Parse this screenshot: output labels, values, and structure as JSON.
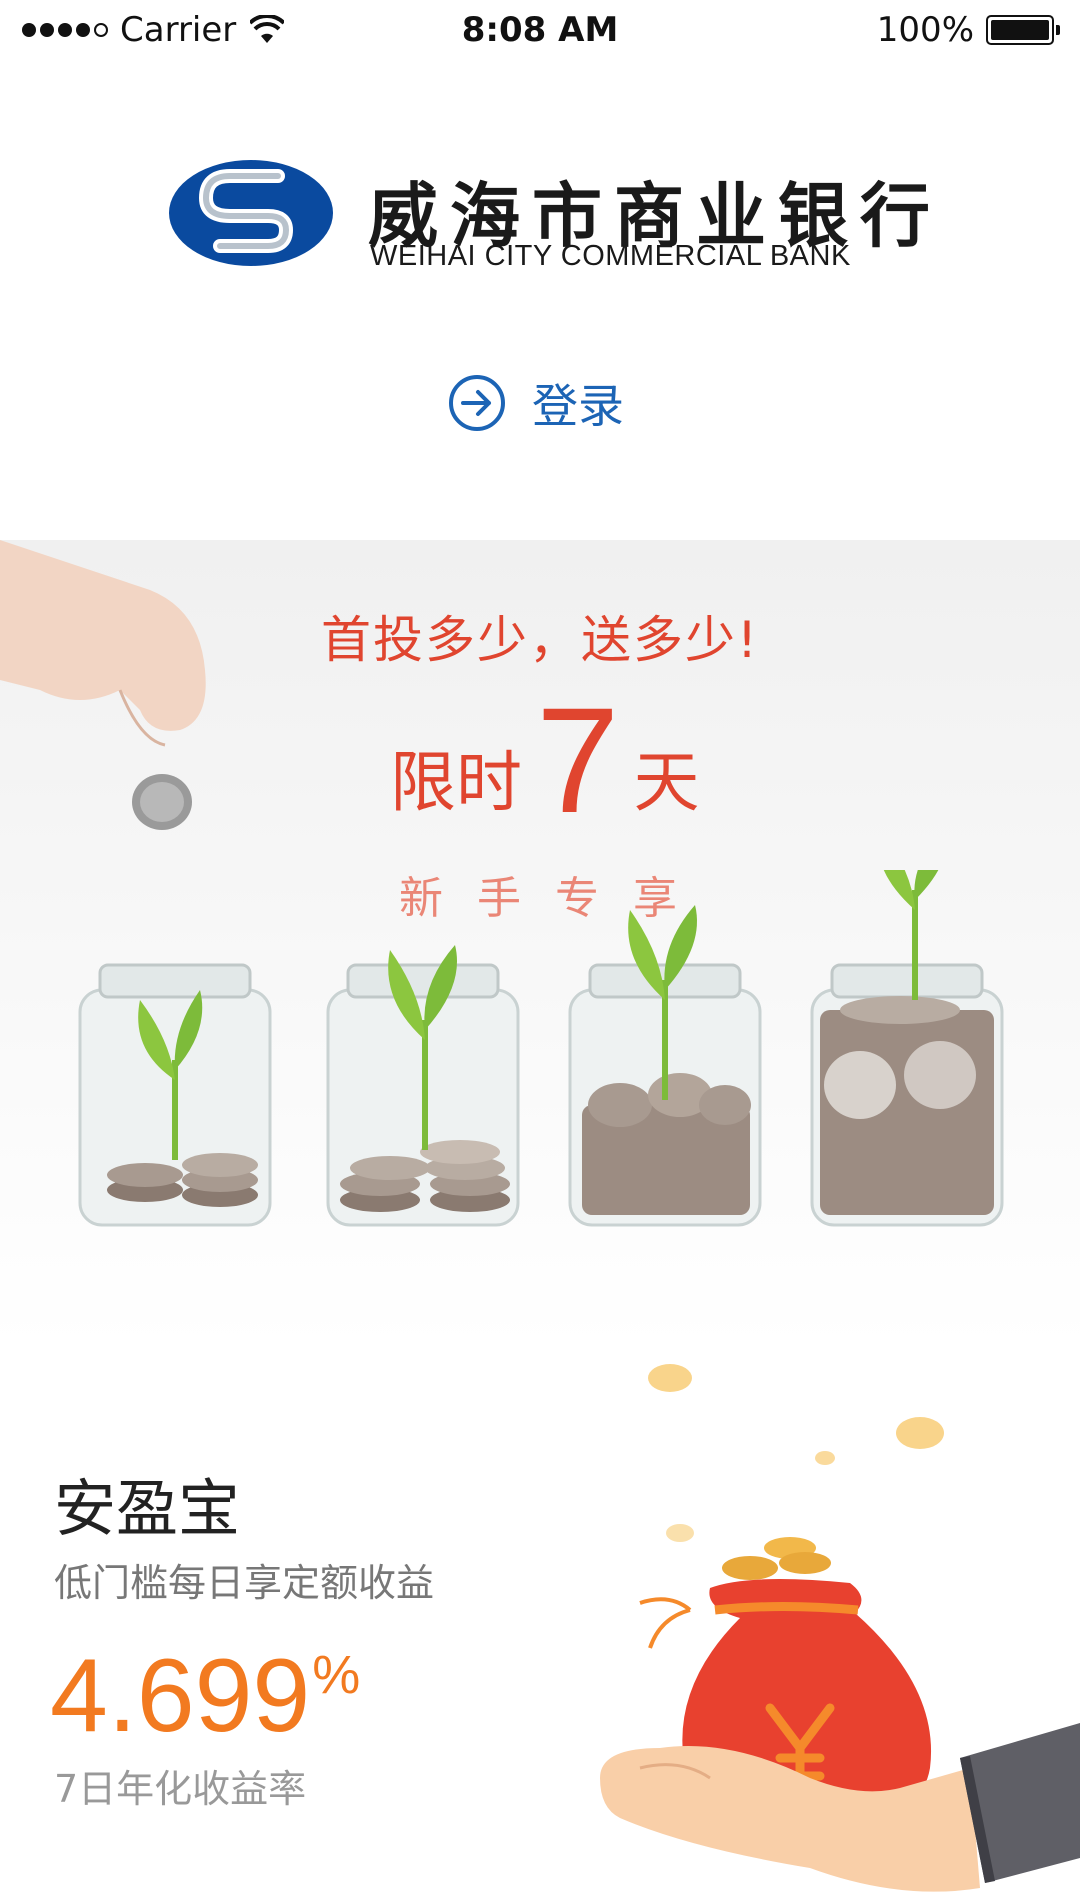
{
  "status_bar": {
    "carrier": "Carrier",
    "time": "8:08 AM",
    "battery": "100%"
  },
  "brand": {
    "name_cn": "威海市商业银行",
    "name_en": "WEIHAI CITY COMMERCIAL BANK",
    "color": "#0a4a9f"
  },
  "login": {
    "label": "登录",
    "icon": "arrow-right-circle-icon",
    "color": "#1c64b5"
  },
  "banner": {
    "headline": "首投多少，送多少!",
    "limited_prefix": "限时",
    "limited_number": "7",
    "limited_suffix": "天",
    "subtitle": "新手专享",
    "accent": "#e0452f"
  },
  "product": {
    "name": "安盈宝",
    "description": "低门槛每日享定额收益",
    "rate_value": "4.699",
    "rate_unit": "%",
    "rate_caption": "7日年化收益率",
    "accent": "#f27a20"
  }
}
